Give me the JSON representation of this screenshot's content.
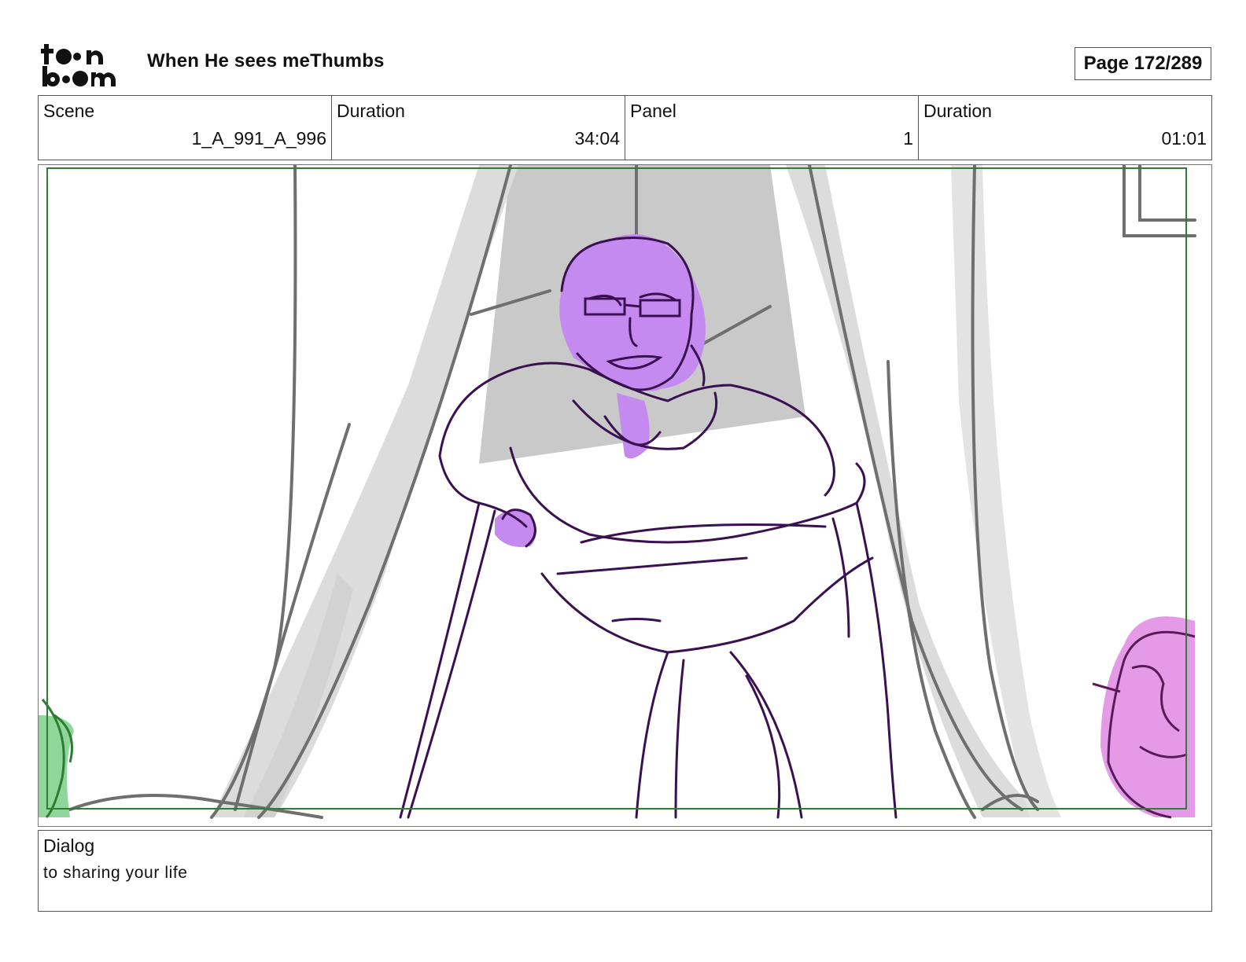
{
  "header": {
    "logo_text": "toon boom",
    "title": "When He sees meThumbs",
    "page_label": "Page 172/289"
  },
  "info": {
    "scene_label": "Scene",
    "scene_value": "1_A_991_A_996",
    "scene_duration_label": "Duration",
    "scene_duration_value": "34:04",
    "panel_label": "Panel",
    "panel_value": "1",
    "panel_duration_label": "Duration",
    "panel_duration_value": "01:01"
  },
  "panel": {
    "safe_frame_color": "#2e7d32",
    "character_main_color": "#c58af0",
    "character_right_color": "#e59ae8",
    "character_left_color": "#8fd69a",
    "lineart_color": "#3a1150",
    "curtain_line_color": "#6f6f6f",
    "curtain_shade_color": "#dcdcdc",
    "window_fill_color": "#c9c9c9"
  },
  "dialog": {
    "label": "Dialog",
    "text": "to sharing your life"
  }
}
